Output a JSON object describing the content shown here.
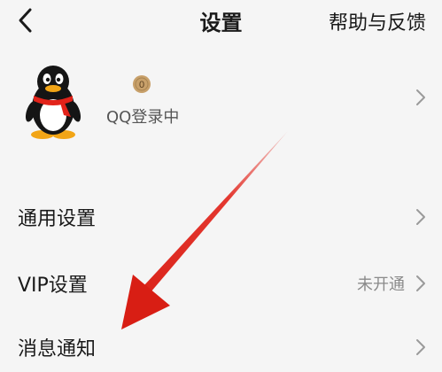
{
  "header": {
    "title": "设置",
    "help_label": "帮助与反馈",
    "back_icon": "chevron-left-icon"
  },
  "account": {
    "coin_count": "0",
    "status": "QQ登录中",
    "avatar_icon": "penguin-avatar-icon"
  },
  "menu": [
    {
      "label": "通用设置",
      "value": ""
    },
    {
      "label": "VIP设置",
      "value": "未开通"
    },
    {
      "label": "消息通知",
      "value": ""
    }
  ],
  "colors": {
    "background": "#f5f5f5",
    "coin": "#c8a06a",
    "annotation_arrow": "#e2231a"
  }
}
